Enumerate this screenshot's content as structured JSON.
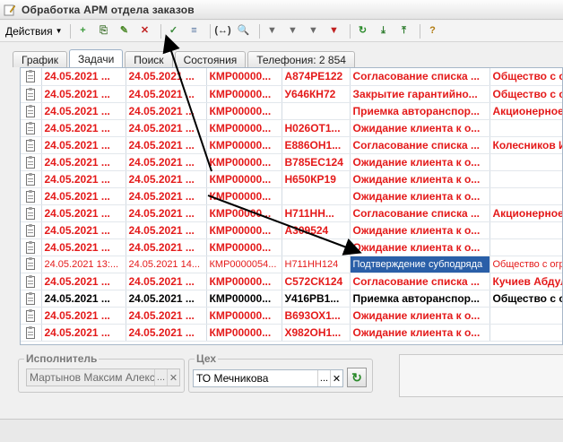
{
  "window": {
    "title": "Обработка  АРМ отдела заказов"
  },
  "toolbar": {
    "actions_label": "Действия",
    "buttons": [
      {
        "icon": "add-circle-icon",
        "glyph": "+",
        "color": "#3a9a3a"
      },
      {
        "icon": "copy-doc-icon",
        "glyph": "⎘",
        "color": "#4a7a3a"
      },
      {
        "icon": "pencil-icon",
        "glyph": "✎",
        "color": "#4d8a2a"
      },
      {
        "icon": "delete-icon",
        "glyph": "✕",
        "color": "#c02020"
      },
      {
        "icon": "doc-check-icon",
        "glyph": "✓",
        "color": "#3a8a3a"
      },
      {
        "icon": "doc-list-icon",
        "glyph": "≡",
        "color": "#4a6a9a"
      },
      {
        "icon": "arrows-lr-icon",
        "glyph": "(↔)",
        "color": "#333"
      },
      {
        "icon": "search-icon",
        "glyph": "🔍",
        "color": "#555"
      },
      {
        "icon": "filter-table-icon",
        "glyph": "▼",
        "color": "#6a6a6a"
      },
      {
        "icon": "filter-icon",
        "glyph": "▼",
        "color": "#6a6a6a"
      },
      {
        "icon": "filter-dropdown-icon",
        "glyph": "▼",
        "color": "#6a6a6a"
      },
      {
        "icon": "filter-clear-icon",
        "glyph": "▼",
        "color": "#c02020"
      },
      {
        "icon": "refresh-icon",
        "glyph": "↻",
        "color": "#2a8a2a"
      },
      {
        "icon": "export-down-icon",
        "glyph": "⤓",
        "color": "#2a7a2a"
      },
      {
        "icon": "export-up-icon",
        "glyph": "⤒",
        "color": "#2a7a2a"
      },
      {
        "icon": "help-icon",
        "glyph": "?",
        "color": "#b07a10"
      }
    ]
  },
  "tabs": [
    {
      "label": "График",
      "active": false
    },
    {
      "label": "Задачи",
      "active": true
    },
    {
      "label": "Поиск",
      "active": false
    },
    {
      "label": "Состояния",
      "active": false
    },
    {
      "label": "Телефония: 2 854",
      "active": false
    }
  ],
  "rows": [
    {
      "style": "red",
      "c1": "24.05.2021 ...",
      "c2": "24.05.2021 ...",
      "c3": "КМР00000...",
      "c4": "А874РЕ122",
      "c5": "Согласование списка ...",
      "c6": "Общество с о"
    },
    {
      "style": "red",
      "c1": "24.05.2021 ...",
      "c2": "24.05.2021 ...",
      "c3": "КМР00000...",
      "c4": "У646КН72",
      "c5": "Закрытие гарантийно...",
      "c6": "Общество с о"
    },
    {
      "style": "red",
      "c1": "24.05.2021 ...",
      "c2": "24.05.2021 ...",
      "c3": "КМР00000...",
      "c4": "",
      "c5": "Приемка авторанспор...",
      "c6": "Акционерное"
    },
    {
      "style": "red",
      "c1": "24.05.2021 ...",
      "c2": "24.05.2021 ...",
      "c3": "КМР00000...",
      "c4": "Н026ОТ1...",
      "c5": "Ожидание клиента к о...",
      "c6": ""
    },
    {
      "style": "red",
      "c1": "24.05.2021 ...",
      "c2": "24.05.2021 ...",
      "c3": "КМР00000...",
      "c4": "Е886ОН1...",
      "c5": "Согласование списка ...",
      "c6": "Колесников И"
    },
    {
      "style": "red",
      "c1": "24.05.2021 ...",
      "c2": "24.05.2021 ...",
      "c3": "КМР00000...",
      "c4": "В785ЕС124",
      "c5": "Ожидание клиента к о...",
      "c6": ""
    },
    {
      "style": "red",
      "c1": "24.05.2021 ...",
      "c2": "24.05.2021 ...",
      "c3": "КМР00000...",
      "c4": "Н650КР19",
      "c5": "Ожидание клиента к о...",
      "c6": ""
    },
    {
      "style": "red",
      "c1": "24.05.2021 ...",
      "c2": "24.05.2021 ...",
      "c3": "КМР00000...",
      "c4": "",
      "c5": "Ожидание клиента к о...",
      "c6": ""
    },
    {
      "style": "red",
      "c1": "24.05.2021 ...",
      "c2": "24.05.2021 ...",
      "c3": "КМР00000...",
      "c4": "Н711НН...",
      "c5": "Согласование списка ...",
      "c6": "Акционерное"
    },
    {
      "style": "red",
      "c1": "24.05.2021 ...",
      "c2": "24.05.2021 ...",
      "c3": "КМР00000...",
      "c4": "А309524",
      "c5": "Ожидание клиента к о...",
      "c6": ""
    },
    {
      "style": "red",
      "c1": "24.05.2021 ...",
      "c2": "24.05.2021 ...",
      "c3": "КМР00000...",
      "c4": "",
      "c5": "Ожидание клиента к о...",
      "c6": ""
    },
    {
      "style": "redlight",
      "c1": "24.05.2021 13:...",
      "c2": "24.05.2021 14...",
      "c3": "КМР0000054...",
      "c4": "Н711НН124",
      "c5": "Подтверждение субподряда",
      "c6": "Общество с огр",
      "sel": true
    },
    {
      "style": "red",
      "c1": "24.05.2021 ...",
      "c2": "24.05.2021 ...",
      "c3": "КМР00000...",
      "c4": "С572СК124",
      "c5": "Согласование списка ...",
      "c6": "Кучиев Абдул"
    },
    {
      "style": "black",
      "c1": "24.05.2021 ...",
      "c2": "24.05.2021 ...",
      "c3": "КМР00000...",
      "c4": "У416РВ1...",
      "c5": "Приемка авторанспор...",
      "c6": "Общество с о"
    },
    {
      "style": "red",
      "c1": "24.05.2021 ...",
      "c2": "24.05.2021 ...",
      "c3": "КМР00000...",
      "c4": "В693ОХ1...",
      "c5": "Ожидание клиента к о...",
      "c6": ""
    },
    {
      "style": "red",
      "c1": "24.05.2021 ...",
      "c2": "24.05.2021 ...",
      "c3": "КМР00000...",
      "c4": "Х982ОН1...",
      "c5": "Ожидание клиента к о...",
      "c6": ""
    }
  ],
  "executor": {
    "legend": "Исполнитель",
    "value": "Мартынов Максим Алексан",
    "btn_select": "...",
    "btn_clear": "✕"
  },
  "shop": {
    "legend": "Цех",
    "value": "ТО Мечникова",
    "btn_select": "...",
    "btn_clear": "✕"
  }
}
